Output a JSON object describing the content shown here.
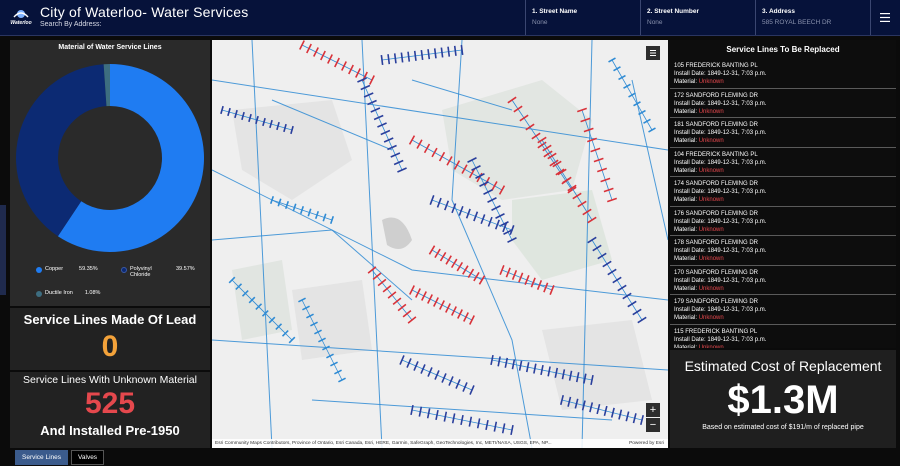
{
  "header": {
    "title": "City of Waterloo- Water Services",
    "subtitle": "Search By Address:",
    "logo_text": "Waterloo",
    "fields": [
      {
        "label": "1. Street Name",
        "value": "None"
      },
      {
        "label": "2. Street Number",
        "value": "None"
      },
      {
        "label": "3. Address",
        "value": "585 ROYAL BEECH DR"
      }
    ],
    "menu_icon": "hamburger-icon"
  },
  "material_chart": {
    "title": "Material of Water Service Lines",
    "legend": [
      {
        "name": "Copper",
        "pct": "59.35%"
      },
      {
        "name": "Polyvinyl Chloride",
        "pct": "39.57%"
      },
      {
        "name": "Ductile Iron",
        "pct": "1.08%"
      }
    ]
  },
  "chart_data": {
    "type": "pie",
    "title": "Material of Water Service Lines",
    "categories": [
      "Copper",
      "Polyvinyl Chloride",
      "Ductile Iron"
    ],
    "values": [
      59.35,
      39.57,
      1.08
    ],
    "colors": [
      "#1f7cf2",
      "#0c2a73",
      "#3d6d80"
    ],
    "legend": "bottom"
  },
  "lead": {
    "label": "Service Lines Made Of Lead",
    "value": "0"
  },
  "unknown": {
    "label": "Service Lines With Unknown Material",
    "value": "525",
    "sub": "And Installed Pre-1950"
  },
  "map": {
    "attribution": "Esri Community Maps Contributors, Province of Ontario, Esri Canada, Esri, HERE, Garmin, SafeGraph, GeoTechnologies, Inc, METI/NASA, USGS, EPA, NP...",
    "powered": "Powered by Esri",
    "zoom_in": "+",
    "zoom_out": "−"
  },
  "replace_list": {
    "title": "Service Lines To Be Replaced",
    "install_prefix": "Install Date:",
    "material_prefix": "Material:",
    "items": [
      {
        "address": "105 FREDERICK BANTING PL",
        "date": "1849-12-31, 7:03 p.m.",
        "material": "Unknown"
      },
      {
        "address": "172 SANDFORD FLEMING DR",
        "date": "1849-12-31, 7:03 p.m.",
        "material": "Unknown"
      },
      {
        "address": "181 SANDFORD FLEMING DR",
        "date": "1849-12-31, 7:03 p.m.",
        "material": "Unknown"
      },
      {
        "address": "104 FREDERICK BANTING PL",
        "date": "1849-12-31, 7:03 p.m.",
        "material": "Unknown"
      },
      {
        "address": "174 SANDFORD FLEMING DR",
        "date": "1849-12-31, 7:03 p.m.",
        "material": "Unknown"
      },
      {
        "address": "176 SANDFORD FLEMING DR",
        "date": "1849-12-31, 7:03 p.m.",
        "material": "Unknown"
      },
      {
        "address": "178 SANDFORD FLEMING DR",
        "date": "1849-12-31, 7:03 p.m.",
        "material": "Unknown"
      },
      {
        "address": "170 SANDFORD FLEMING DR",
        "date": "1849-12-31, 7:03 p.m.",
        "material": "Unknown"
      },
      {
        "address": "179 SANDFORD FLEMING DR",
        "date": "1849-12-31, 7:03 p.m.",
        "material": "Unknown"
      },
      {
        "address": "115 FREDERICK BANTING PL",
        "date": "1849-12-31, 7:03 p.m.",
        "material": "Unknown"
      }
    ]
  },
  "cost": {
    "title": "Estimated Cost of Replacement",
    "value": "$1.3M",
    "note": "Based on estimated cost of $191/m of replaced pipe"
  },
  "tabs": [
    {
      "label": "Service Lines",
      "active": true
    },
    {
      "label": "Valves",
      "active": false
    }
  ],
  "colors": {
    "header_bg": "#06123a",
    "copper": "#1f7cf2",
    "pvc": "#0c2a73",
    "ductile": "#3d6d80",
    "lead_value": "#f3a23a",
    "unknown_value": "#e5484d",
    "pipe_blue": "#2f8bd4",
    "service_red": "#d9323a"
  }
}
